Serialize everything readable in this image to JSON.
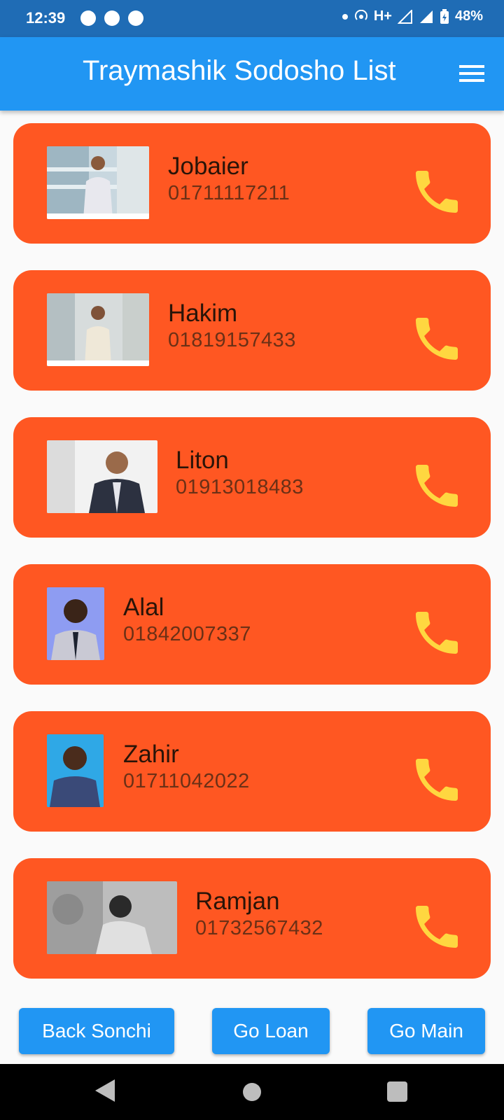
{
  "status_bar": {
    "time": "12:39",
    "network": "H+",
    "battery": "48%",
    "notification_icons": [
      "pinterest-icon",
      "messenger-icon",
      "pinterest-icon"
    ]
  },
  "app_bar": {
    "title": "Traymashik Sodosho List",
    "menu_icon": "menu-icon"
  },
  "colors": {
    "status_bar": "#1f6cb5",
    "app_bar": "#2196f3",
    "card": "#ff5722",
    "call_icon": "#ffd740",
    "background": "#fafafa",
    "button": "#2196f3"
  },
  "contacts": [
    {
      "name": "Jobaier",
      "phone": "01711117211",
      "call_icon": "phone-icon"
    },
    {
      "name": "Hakim",
      "phone": "01819157433",
      "call_icon": "phone-icon"
    },
    {
      "name": "Liton",
      "phone": "01913018483",
      "call_icon": "phone-icon"
    },
    {
      "name": "Alal",
      "phone": "01842007337",
      "call_icon": "phone-icon"
    },
    {
      "name": "Zahir",
      "phone": "01711042022",
      "call_icon": "phone-icon"
    },
    {
      "name": "Ramjan",
      "phone": "01732567432",
      "call_icon": "phone-icon"
    }
  ],
  "buttons": {
    "back": "Back Sonchi",
    "loan": "Go Loan",
    "main": "Go Main"
  },
  "nav_bar": {
    "back_icon": "back-triangle-icon",
    "home_icon": "home-circle-icon",
    "recents_icon": "recents-square-icon"
  }
}
